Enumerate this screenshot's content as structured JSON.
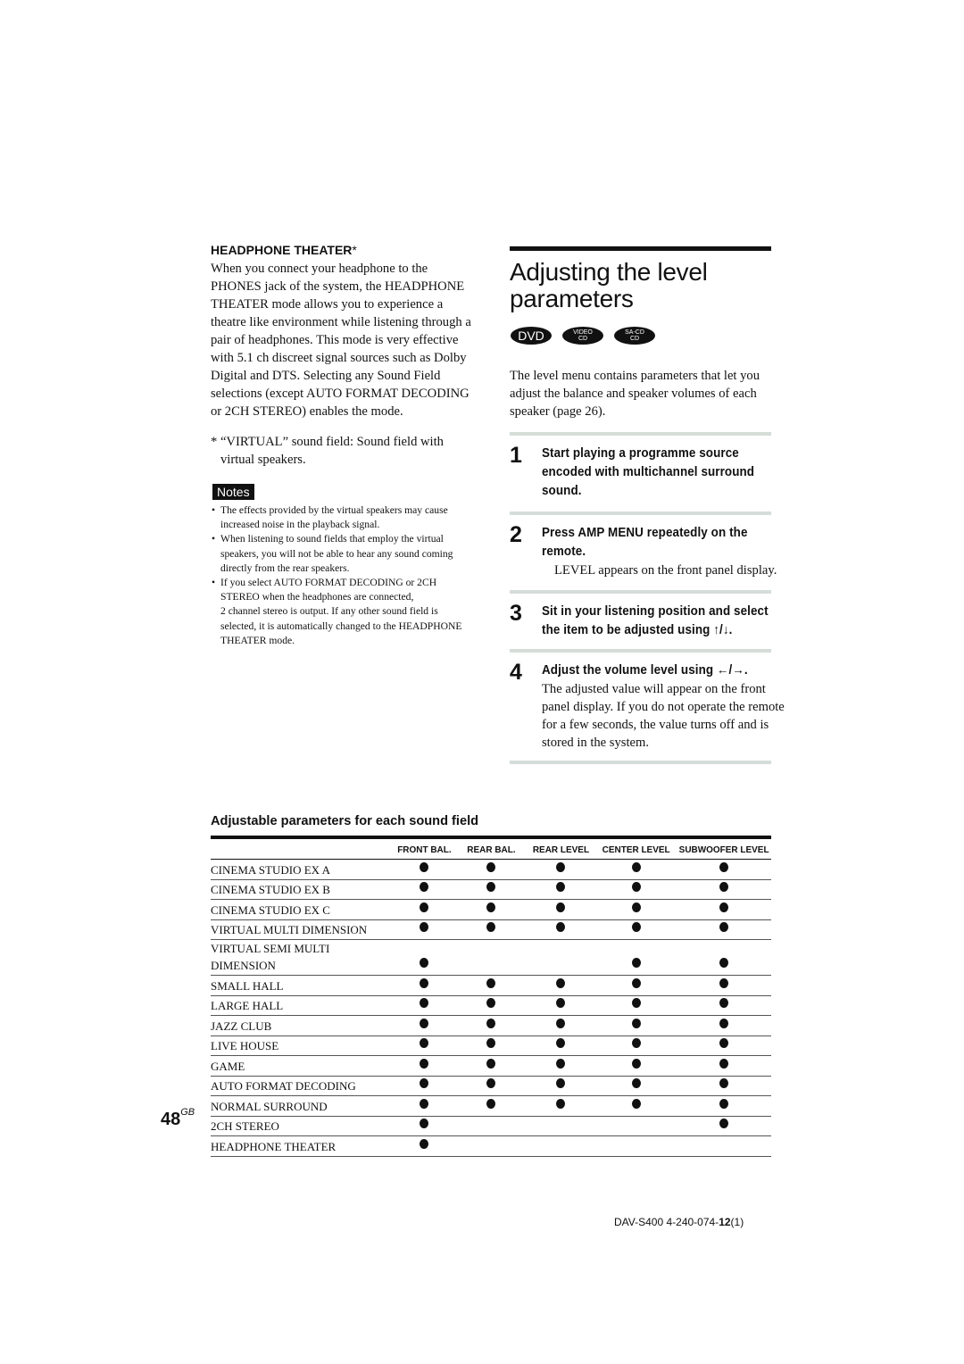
{
  "left": {
    "heading": "HEADPHONE THEATER",
    "heading_asterisk": "*",
    "paragraph": "When you connect your headphone to the PHONES jack of the system, the HEADPHONE THEATER mode allows you to experience a theatre like environment while listening through a pair of headphones. This mode is very effective with 5.1 ch discreet signal sources such as Dolby Digital and DTS. Selecting any Sound Field selections (except AUTO FORMAT DECODING or 2CH STEREO) enables the mode.",
    "footnote": "* “VIRTUAL” sound field: Sound field with virtual speakers.",
    "notes_label": "Notes",
    "notes": [
      "The effects provided by the virtual speakers may cause increased noise in the playback signal.",
      "When listening to sound fields that employ the virtual speakers, you will not be able to hear any sound coming directly from the rear speakers.",
      "If you select AUTO FORMAT DECODING or 2CH STEREO when the headphones are connected,"
    ],
    "notes_continuation": "2 channel stereo is output. If any other sound field is selected, it is automatically changed to the HEADPHONE THEATER mode."
  },
  "right": {
    "title": "Adjusting the level parameters",
    "badges": [
      {
        "line1": "DVD",
        "line2": ""
      },
      {
        "line1": "VIDEO",
        "line2": "CD"
      },
      {
        "line1": "SA-CD",
        "line2": "CD"
      }
    ],
    "intro": "The level menu contains parameters that let you adjust the balance and speaker volumes of each speaker (page 26).",
    "steps": [
      {
        "number": "1",
        "title": "Start playing a programme source encoded with multichannel surround sound.",
        "body": ""
      },
      {
        "number": "2",
        "title": "Press AMP MENU repeatedly on the remote.",
        "body": "LEVEL appears on the front panel display."
      },
      {
        "number": "3",
        "title": "Sit in your listening position and select the item to be adjusted using ↑/↓.",
        "body": ""
      },
      {
        "number": "4",
        "title": "Adjust the volume level using ←/→.",
        "body": "The adjusted value will appear on the front panel display. If you do not operate the remote for a few seconds, the value turns off and is stored in the system."
      }
    ]
  },
  "table": {
    "title": "Adjustable parameters for each sound field",
    "columns": [
      "FRONT BAL.",
      "REAR BAL.",
      "REAR LEVEL",
      "CENTER LEVEL",
      "SUBWOOFER LEVEL"
    ],
    "rows": [
      {
        "name": "CINEMA STUDIO EX A",
        "marks": [
          true,
          true,
          true,
          true,
          true
        ]
      },
      {
        "name": "CINEMA STUDIO EX B",
        "marks": [
          true,
          true,
          true,
          true,
          true
        ]
      },
      {
        "name": "CINEMA STUDIO EX C",
        "marks": [
          true,
          true,
          true,
          true,
          true
        ]
      },
      {
        "name": "VIRTUAL MULTI DIMENSION",
        "marks": [
          true,
          true,
          true,
          true,
          true
        ]
      },
      {
        "name": "VIRTUAL SEMI MULTI DIMENSION",
        "marks": [
          true,
          false,
          false,
          true,
          true
        ]
      },
      {
        "name": "SMALL HALL",
        "marks": [
          true,
          true,
          true,
          true,
          true
        ]
      },
      {
        "name": "LARGE HALL",
        "marks": [
          true,
          true,
          true,
          true,
          true
        ]
      },
      {
        "name": "JAZZ CLUB",
        "marks": [
          true,
          true,
          true,
          true,
          true
        ]
      },
      {
        "name": "LIVE HOUSE",
        "marks": [
          true,
          true,
          true,
          true,
          true
        ]
      },
      {
        "name": "GAME",
        "marks": [
          true,
          true,
          true,
          true,
          true
        ]
      },
      {
        "name": "AUTO FORMAT DECODING",
        "marks": [
          true,
          true,
          true,
          true,
          true
        ]
      },
      {
        "name": "NORMAL SURROUND",
        "marks": [
          true,
          true,
          true,
          true,
          true
        ]
      },
      {
        "name": "2CH STEREO",
        "marks": [
          true,
          false,
          false,
          false,
          true
        ]
      },
      {
        "name": "HEADPHONE THEATER",
        "marks": [
          true,
          false,
          false,
          false,
          false
        ]
      }
    ]
  },
  "footer": {
    "page_number": "48",
    "page_suffix": "GB",
    "code_prefix": "DAV-S400 4-240-074-",
    "code_bold": "12",
    "code_suffix": "(1)"
  }
}
